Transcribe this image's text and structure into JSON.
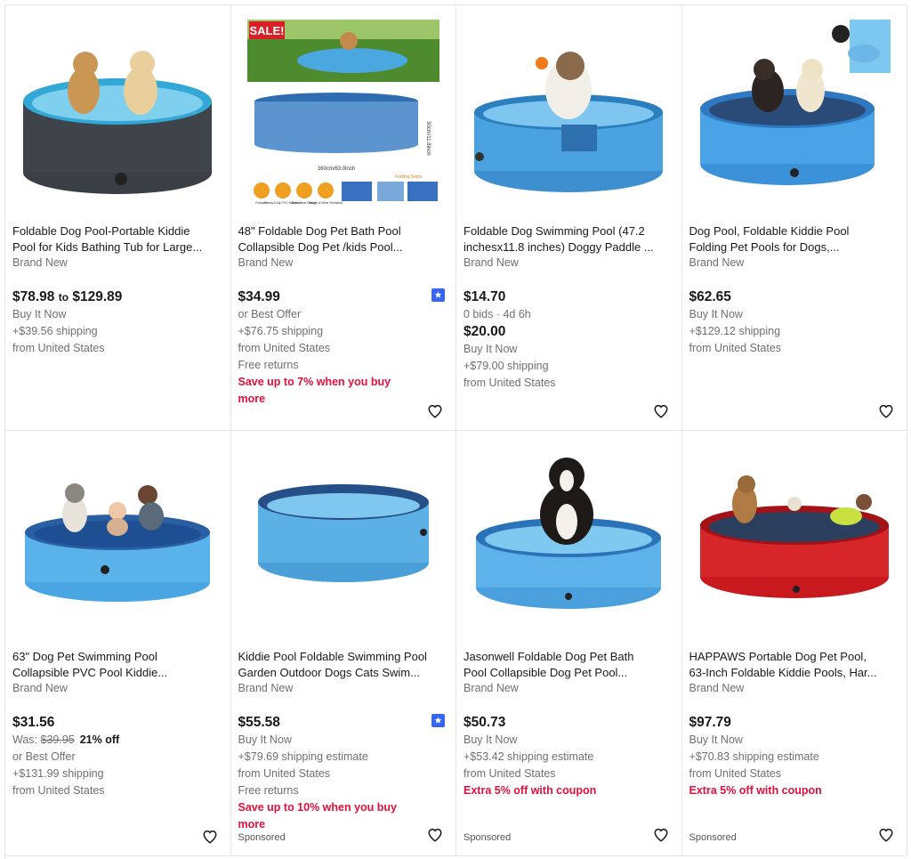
{
  "items": [
    {
      "title_l1": "Foldable Dog Pool-Portable Kiddie",
      "title_l2": "Pool for Kids Bathing Tub for Large...",
      "condition": "Brand New",
      "price_low": "$78.98",
      "price_to": "to",
      "price_high": "$129.89",
      "lines": [
        "Buy It Now",
        "+$39.56 shipping",
        "from United States"
      ]
    },
    {
      "title_l1": "48\" Foldable Dog Pet Bath Pool",
      "title_l2": "Collapsible Dog Pet /kids Pool...",
      "condition": "Brand New",
      "price": "$34.99",
      "lines": [
        "or Best Offer",
        "+$76.75 shipping",
        "from United States",
        "Free returns"
      ],
      "promo": "Save up to 7% when you buy more",
      "image_sale_label": "SALE!",
      "image_dim1": "160cm/63.0inch",
      "image_dim2": "30cm/11.8inch",
      "image_steps": "Folding Steps",
      "image_feat": [
        "Foldable",
        "Heavy-Duty PVC Materials",
        "Drain Hole Design",
        "Sturdy & Wear Resistant"
      ]
    },
    {
      "title_l1": "Foldable Dog Swimming Pool (47.2",
      "title_l2": "inchesx11.8 inches) Doggy Paddle ...",
      "condition": "Brand New",
      "price": "$14.70",
      "bids": "0 bids · 4d 6h",
      "price2": "$20.00",
      "lines": [
        "Buy It Now",
        "+$79.00 shipping",
        "from United States"
      ]
    },
    {
      "title_l1": "Dog Pool, Foldable Kiddie Pool",
      "title_l2": "Folding Pet Pools for Dogs,...",
      "condition": "Brand New",
      "price": "$62.65",
      "lines": [
        "Buy It Now",
        "+$129.12 shipping",
        "from United States"
      ]
    },
    {
      "title_l1": "63\" Dog Pet Swimming Pool",
      "title_l2": "Collapsible PVC Pool Kiddie...",
      "condition": "Brand New",
      "price": "$31.56",
      "was_label": "Was:",
      "was_price": "$39.95",
      "off": "21% off",
      "lines": [
        "or Best Offer",
        "+$131.99 shipping",
        "from United States"
      ]
    },
    {
      "title_l1": "Kiddie Pool Foldable Swimming Pool",
      "title_l2": "Garden Outdoor Dogs Cats Swim...",
      "condition": "Brand New",
      "price": "$55.58",
      "lines": [
        "Buy It Now",
        "+$79.69 shipping estimate",
        "from United States",
        "Free returns"
      ],
      "promo": "Save up to 10% when you buy more",
      "sponsored": "Sponsored"
    },
    {
      "title_l1": "Jasonwell Foldable Dog Pet Bath",
      "title_l2": "Pool Collapsible Dog Pet Pool...",
      "condition": "Brand New",
      "price": "$50.73",
      "lines": [
        "Buy It Now",
        "+$53.42 shipping estimate",
        "from United States"
      ],
      "promo": "Extra 5% off with coupon",
      "sponsored": "Sponsored"
    },
    {
      "title_l1": "HAPPAWS Portable Dog Pet Pool,",
      "title_l2": "63-Inch Foldable Kiddie Pools, Har...",
      "condition": "Brand New",
      "price": "$97.79",
      "lines": [
        "Buy It Now",
        "+$70.83 shipping estimate",
        "from United States"
      ],
      "promo": "Extra 5% off with coupon",
      "sponsored": "Sponsored"
    }
  ],
  "icons": {
    "heart": "heart-outline-icon",
    "badge": "top-rated-seller-icon"
  },
  "colors": {
    "promo_red": "#e0103a",
    "badge_blue": "#3665f3",
    "muted": "#707070"
  }
}
